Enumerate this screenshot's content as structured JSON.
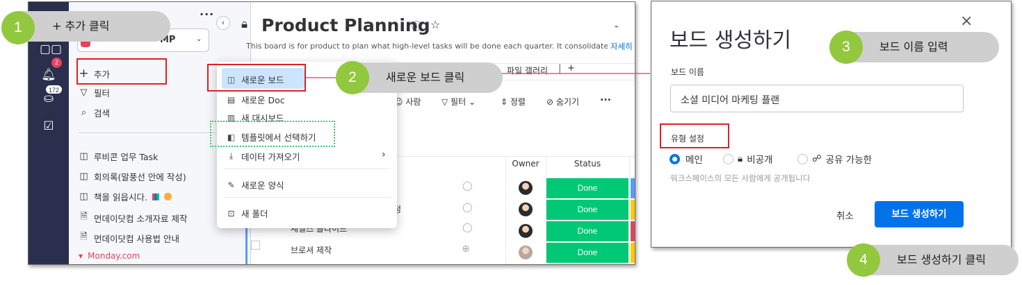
{
  "sidebar": {
    "workspace_text": "MP",
    "items": {
      "add": "추가",
      "filter": "필터",
      "search": "검색",
      "b1": "루비콘 업무 Task",
      "b2": "회의록(말풍선 안에 작성)",
      "b3": "책을 읽읍시다.",
      "b4": "먼데이닷컴 소개자료 제작",
      "b5": "먼데이닷컴 사용법 안내",
      "b6": "Monday.com"
    },
    "inbox_badge": "2",
    "notif_badge": "172"
  },
  "board": {
    "title": "Product Planning",
    "description": "This board is for product to plan what high-level tasks will be done each quarter. It consolidate...",
    "more_link": "자세히",
    "tab_gallery": "파일 갤러리",
    "tab_add": "+",
    "toolbar": {
      "person": "사람",
      "filter": "필터",
      "sort": "정렬",
      "hide": "숨기기",
      "more": "..."
    },
    "columns": {
      "owner": "Owner",
      "status": "Status"
    },
    "rows": [
      {
        "name": "",
        "status": "Done"
      },
      {
        "name": "청",
        "status": "Done"
      },
      {
        "name": "세일즈 슬라이드",
        "status": "Done"
      },
      {
        "name": "브로셔 제작",
        "status": "Done"
      }
    ]
  },
  "add_menu": {
    "items": [
      "새로운 보드",
      "새로운 Doc",
      "새 대시보드",
      "템플릿에서 선택하기",
      "데이터 가져오기",
      "새로운 양식",
      "새 폴더"
    ]
  },
  "dialog": {
    "title": "보드 생성하기",
    "close": "×",
    "name_label": "보드 이름",
    "name_value": "소셜 미디어 마케팅 플랜",
    "type_label": "유형 설정",
    "options": [
      "메인",
      "비공개",
      "공유 가능한"
    ],
    "selected_option": "메인",
    "helper": "워크스페이스의 모든 사람에게 공개됩니다",
    "cancel": "취소",
    "create": "보드 생성하기"
  },
  "callouts": [
    {
      "num": "1",
      "text": "+ 추가 클릭"
    },
    {
      "num": "2",
      "text": "새로운 보드 클릭"
    },
    {
      "num": "3",
      "text": "보드 이름 입력"
    },
    {
      "num": "4",
      "text": "보드 생성하기 클릭"
    }
  ],
  "colors": {
    "rail": "#292f4c",
    "done_green": "#00c875",
    "primary_blue": "#0073ea",
    "callout_green": "#92c83e",
    "callout_gray": "#cfcfcf",
    "highlight_red": "#e02020",
    "template_dashed": "#2ecc71",
    "arrow_pink": "#e8336d"
  },
  "icons": [
    "bell-icon",
    "inbox-icon",
    "calendar-check-icon",
    "lock-icon",
    "star-icon",
    "info-icon",
    "board-icon",
    "doc-icon",
    "dashboard-icon",
    "template-icon",
    "import-icon",
    "form-icon",
    "folder-icon",
    "share-icon"
  ]
}
